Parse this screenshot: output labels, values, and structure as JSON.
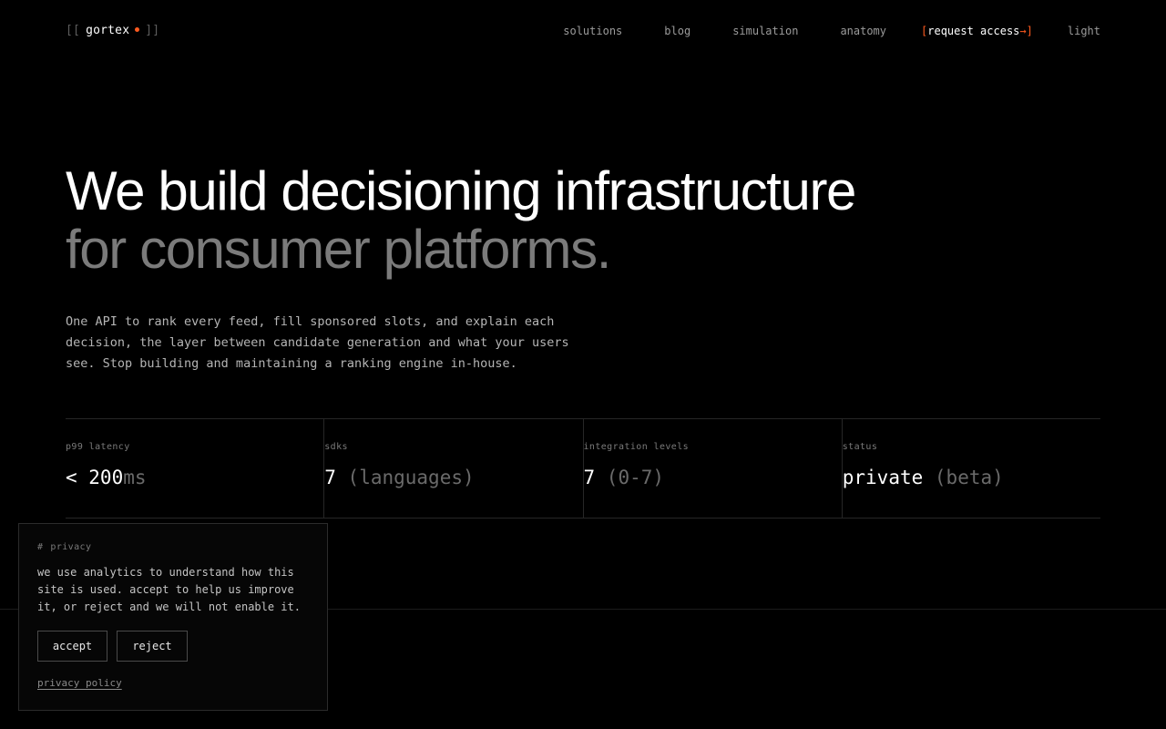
{
  "colors": {
    "background": "#000000",
    "accent": "#ff5a1f"
  },
  "header": {
    "logo": {
      "open_bracket": "[[",
      "name": "gortex",
      "close_bracket": "]]"
    },
    "nav": {
      "items": [
        {
          "label": "solutions"
        },
        {
          "label": "blog"
        },
        {
          "label": "simulation"
        },
        {
          "label": "anatomy"
        }
      ],
      "cta": {
        "open_bracket": "[",
        "label": "request access",
        "arrow": "→",
        "close_bracket": "]"
      },
      "theme_toggle": "light"
    }
  },
  "hero": {
    "title_line1": "We build decisioning infrastructure",
    "title_line2": "for consumer platforms.",
    "description": "One API to rank every feed, fill sponsored slots, and explain each decision, the layer between candidate generation and what your users see. Stop building and maintaining a ranking engine in-house."
  },
  "stats": [
    {
      "label": "p99 latency",
      "value": "< 200",
      "suffix": "ms"
    },
    {
      "label": "sdks",
      "value": "7",
      "suffix": " (languages)"
    },
    {
      "label": "integration levels",
      "value": "7",
      "suffix": " (0-7)"
    },
    {
      "label": "status",
      "value": "private",
      "suffix": " (beta)"
    }
  ],
  "privacy": {
    "hash": "#",
    "title": "privacy",
    "text": "we use analytics to understand how this site is used. accept to help us improve it, or reject and we will not enable it.",
    "accept_label": "accept",
    "reject_label": "reject",
    "policy_link": "privacy policy"
  }
}
